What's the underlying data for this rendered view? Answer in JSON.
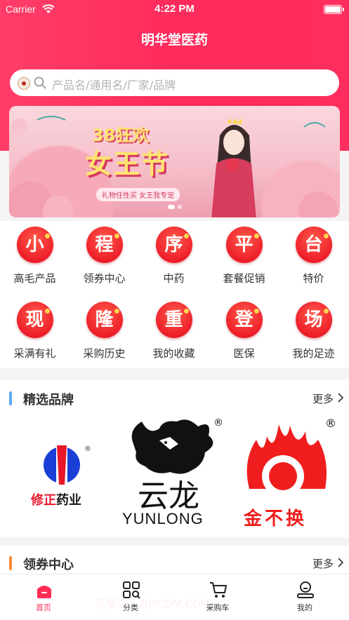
{
  "status_bar": {
    "carrier": "Carrier",
    "time": "4:22 PM"
  },
  "header": {
    "title": "明华堂医药"
  },
  "search": {
    "placeholder": "产品名/通用名/厂家/品牌"
  },
  "banner": {
    "line1": "38狂欢",
    "line2": "女王节",
    "tagline": "礼物任性买 女王我专宠"
  },
  "quick_menu": [
    {
      "char": "小",
      "label": "高毛产品"
    },
    {
      "char": "程",
      "label": "领券中心"
    },
    {
      "char": "序",
      "label": "中药"
    },
    {
      "char": "平",
      "label": "套餐促销"
    },
    {
      "char": "台",
      "label": "特价"
    },
    {
      "char": "现",
      "label": "采满有礼"
    },
    {
      "char": "隆",
      "label": "采购历史"
    },
    {
      "char": "重",
      "label": "我的收藏"
    },
    {
      "char": "登",
      "label": "医保"
    },
    {
      "char": "场",
      "label": "我的足迹"
    }
  ],
  "brands": {
    "title": "精选品牌",
    "more": "更多",
    "accent": "#5aa9f5",
    "items": [
      {
        "name": "修正药业",
        "text_a": "修正",
        "text_b": "药业"
      },
      {
        "name": "云龙",
        "text_a": "云龙",
        "text_b": "YUNLONG"
      },
      {
        "name": "金不换",
        "text_a": "金不换"
      }
    ]
  },
  "coupons": {
    "title": "领券中心",
    "more": "更多",
    "accent": "#ff8a3d"
  },
  "tabbar": [
    {
      "label": "首页",
      "icon": "home-icon",
      "active": true
    },
    {
      "label": "分类",
      "icon": "category-icon",
      "active": false
    },
    {
      "label": "采购车",
      "icon": "cart-icon",
      "active": false
    },
    {
      "label": "我的",
      "icon": "profile-icon",
      "active": false
    }
  ],
  "watermark": "乐享汇 • NJYCOM.COM",
  "colors": {
    "primary": "#ff2d55",
    "header": "#ff3d68"
  }
}
